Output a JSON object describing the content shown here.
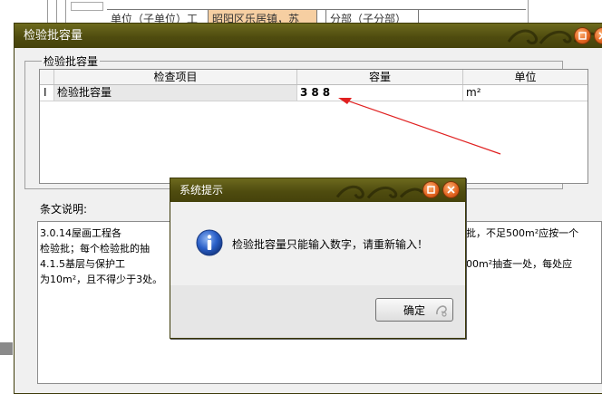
{
  "background": {
    "row_cells": [
      "单位（子单位）工",
      "昭阳区乐居镇，苏",
      "",
      "分部（子分部）"
    ],
    "colors": {
      "highlight_cell": "#f6cfa2"
    }
  },
  "main_dialog": {
    "title": "检验批容量",
    "group_title": "检验批容量",
    "grid": {
      "columns": [
        "检查项目",
        "容量",
        "单位"
      ],
      "row_indicator": "I",
      "rows": [
        {
          "item": "检验批容量",
          "capacity": "388",
          "unit": "m²"
        }
      ]
    },
    "explain_label": "条文说明:",
    "explain_lines": [
      "        3.0.14屋画工程各",
      "检验批；每个检验批的抽",
      "        4.1.5基层与保护工",
      "为10m²，且不得少于3处。"
    ],
    "explain_lines_right": [
      "批，不足500m²应按一个",
      "",
      "00m²抽查一处，每处应",
      ""
    ]
  },
  "message_dialog": {
    "title": "系统提示",
    "message": "检验批容量只能输入数字，请重新输入！",
    "ok_label": "确定"
  },
  "colors": {
    "titlebar": "#4f4c0f",
    "close_button": "#e0621e",
    "arrow": "#e02020",
    "info_icon": "#2a5fc8"
  },
  "icons": [
    "minimize-icon",
    "close-icon",
    "info-icon",
    "arrow-annotation"
  ]
}
